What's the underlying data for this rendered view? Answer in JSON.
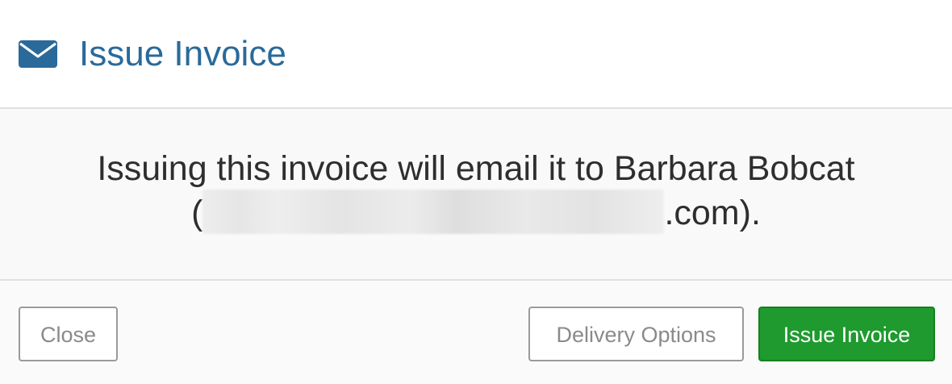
{
  "header": {
    "icon": "envelope-icon",
    "title": "Issue Invoice"
  },
  "body": {
    "message_prefix": "Issuing this invoice will email it to Barbara Bobcat",
    "email_open_paren": "(",
    "email_suffix": ".com).",
    "email_redacted": true
  },
  "footer": {
    "close_label": "Close",
    "delivery_label": "Delivery Options",
    "issue_label": "Issue Invoice"
  },
  "colors": {
    "title": "#2a6a9a",
    "primary_button": "#1e9a2e",
    "body_background": "#f9f9f9"
  }
}
